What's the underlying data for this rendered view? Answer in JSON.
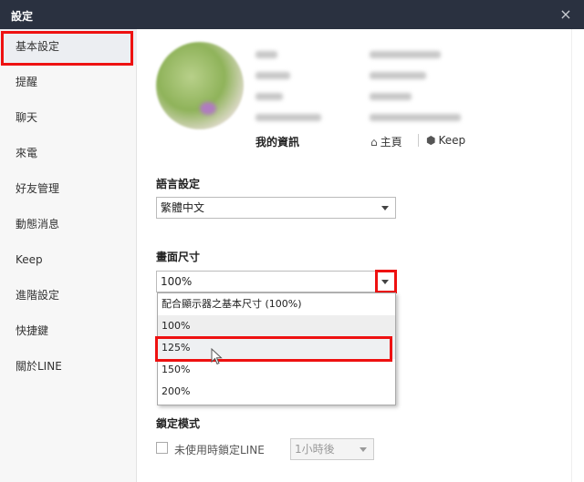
{
  "window": {
    "title": "設定",
    "close_icon": "×"
  },
  "sidebar": {
    "items": [
      {
        "label": "基本設定",
        "active": true
      },
      {
        "label": "提醒"
      },
      {
        "label": "聊天"
      },
      {
        "label": "來電"
      },
      {
        "label": "好友管理"
      },
      {
        "label": "動態消息"
      },
      {
        "label": "Keep"
      },
      {
        "label": "進階設定"
      },
      {
        "label": "快捷鍵"
      },
      {
        "label": "關於LINE"
      }
    ]
  },
  "profile": {
    "my_info_label": "我的資訊",
    "home_link": "主頁",
    "keep_link": "Keep"
  },
  "language": {
    "label": "語言設定",
    "value": "繁體中文"
  },
  "screen_size": {
    "label": "畫面尺寸",
    "value": "100%",
    "options": [
      "配合顯示器之基本尺寸 (100%)",
      "100%",
      "125%",
      "150%",
      "200%"
    ]
  },
  "lock": {
    "label": "鎖定模式",
    "checkbox_label": "未使用時鎖定LINE",
    "select_value": "1小時後"
  },
  "colors": {
    "titlebar": "#2a3140",
    "highlight": "#ee1111"
  }
}
